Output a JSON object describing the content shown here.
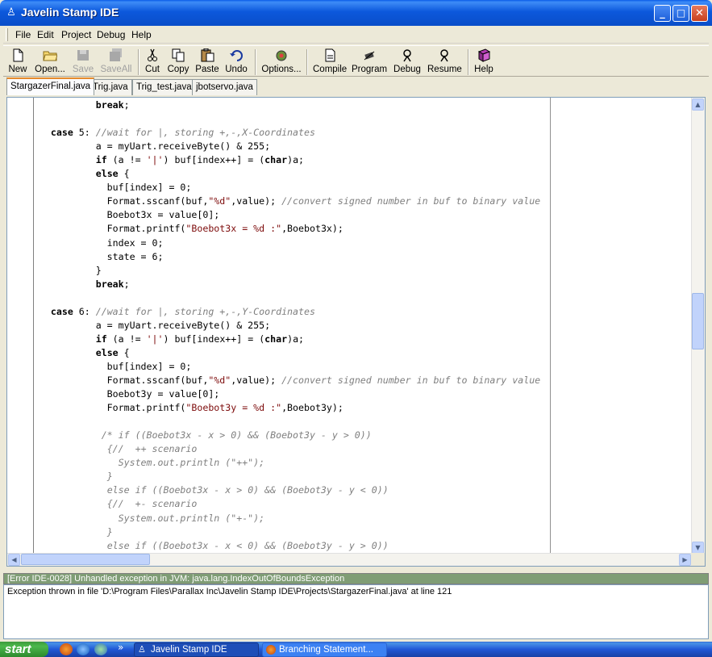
{
  "window": {
    "title": "Javelin Stamp IDE",
    "min": "_",
    "max": "□",
    "close": "✕"
  },
  "menu": [
    "File",
    "Edit",
    "Project",
    "Debug",
    "Help"
  ],
  "toolbar": {
    "new": "New",
    "open": "Open...",
    "save": "Save",
    "saveall": "SaveAll",
    "cut": "Cut",
    "copy": "Copy",
    "paste": "Paste",
    "undo": "Undo",
    "options": "Options...",
    "compile": "Compile",
    "program": "Program",
    "debug": "Debug",
    "resume": "Resume",
    "help": "Help"
  },
  "tabs": [
    "StargazerFinal.java",
    "Trig.java",
    "Trig_test.java",
    "jbotservo.java"
  ],
  "code": [
    [
      [
        "              ",
        ""
      ],
      [
        "break",
        "kw"
      ],
      [
        ";",
        ""
      ]
    ],
    [
      [
        "",
        ""
      ]
    ],
    [
      [
        "      ",
        ""
      ],
      [
        "case",
        "kw"
      ],
      [
        " 5: ",
        ""
      ],
      [
        "//wait for |, storing +,-,X-Coordinates",
        "cm"
      ]
    ],
    [
      [
        "              a = myUart.receiveByte() & 255;",
        ""
      ]
    ],
    [
      [
        "              ",
        ""
      ],
      [
        "if",
        "kw"
      ],
      [
        " (a != ",
        ""
      ],
      [
        "'|'",
        "st"
      ],
      [
        ") buf[index++] = (",
        ""
      ],
      [
        "char",
        "kw"
      ],
      [
        ")a;",
        ""
      ]
    ],
    [
      [
        "              ",
        ""
      ],
      [
        "else",
        "kw"
      ],
      [
        " {",
        ""
      ]
    ],
    [
      [
        "                buf[index] = 0;",
        ""
      ]
    ],
    [
      [
        "                Format.sscanf(buf,",
        ""
      ],
      [
        "\"%d\"",
        "st"
      ],
      [
        ",value); ",
        ""
      ],
      [
        "//convert signed number in buf to binary value",
        "cm"
      ]
    ],
    [
      [
        "                Boebot3x = value[0];",
        ""
      ]
    ],
    [
      [
        "                Format.printf(",
        ""
      ],
      [
        "\"Boebot3x = %d :\"",
        "st"
      ],
      [
        ",Boebot3x);",
        ""
      ]
    ],
    [
      [
        "                index = 0;",
        ""
      ]
    ],
    [
      [
        "                state = 6;",
        ""
      ]
    ],
    [
      [
        "              }",
        ""
      ]
    ],
    [
      [
        "              ",
        ""
      ],
      [
        "break",
        "kw"
      ],
      [
        ";",
        ""
      ]
    ],
    [
      [
        "",
        ""
      ]
    ],
    [
      [
        "      ",
        ""
      ],
      [
        "case",
        "kw"
      ],
      [
        " 6: ",
        ""
      ],
      [
        "//wait for |, storing +,-,Y-Coordinates",
        "cm"
      ]
    ],
    [
      [
        "              a = myUart.receiveByte() & 255;",
        ""
      ]
    ],
    [
      [
        "              ",
        ""
      ],
      [
        "if",
        "kw"
      ],
      [
        " (a != ",
        ""
      ],
      [
        "'|'",
        "st"
      ],
      [
        ") buf[index++] = (",
        ""
      ],
      [
        "char",
        "kw"
      ],
      [
        ")a;",
        ""
      ]
    ],
    [
      [
        "              ",
        ""
      ],
      [
        "else",
        "kw"
      ],
      [
        " {",
        ""
      ]
    ],
    [
      [
        "                buf[index] = 0;",
        ""
      ]
    ],
    [
      [
        "                Format.sscanf(buf,",
        ""
      ],
      [
        "\"%d\"",
        "st"
      ],
      [
        ",value); ",
        ""
      ],
      [
        "//convert signed number in buf to binary value",
        "cm"
      ]
    ],
    [
      [
        "                Boebot3y = value[0];",
        ""
      ]
    ],
    [
      [
        "                Format.printf(",
        ""
      ],
      [
        "\"Boebot3y = %d :\"",
        "st"
      ],
      [
        ",Boebot3y);",
        ""
      ]
    ],
    [
      [
        "",
        ""
      ]
    ],
    [
      [
        "               ",
        ""
      ],
      [
        "/* if ((Boebot3x - x > 0) && (Boebot3y - y > 0))",
        "cm"
      ]
    ],
    [
      [
        "                ",
        ""
      ],
      [
        "{//  ++ scenario",
        "cm"
      ]
    ],
    [
      [
        "                  ",
        ""
      ],
      [
        "System.out.println (\"++\");",
        "cm"
      ]
    ],
    [
      [
        "                ",
        ""
      ],
      [
        "}",
        "cm"
      ]
    ],
    [
      [
        "                ",
        ""
      ],
      [
        "else if ((Boebot3x - x > 0) && (Boebot3y - y < 0))",
        "cm"
      ]
    ],
    [
      [
        "                ",
        ""
      ],
      [
        "{//  +- scenario",
        "cm"
      ]
    ],
    [
      [
        "                  ",
        ""
      ],
      [
        "System.out.println (\"+-\");",
        "cm"
      ]
    ],
    [
      [
        "                ",
        ""
      ],
      [
        "}",
        "cm"
      ]
    ],
    [
      [
        "                ",
        ""
      ],
      [
        "else if ((Boebot3x - x < 0) && (Boebot3y - y > 0))",
        "cm"
      ]
    ]
  ],
  "output": {
    "error": "[Error IDE-0028] Unhandled exception in JVM: java.lang.IndexOutOfBoundsException",
    "message": "Exception thrown in file 'D:\\Program Files\\Parallax Inc\\Javelin Stamp IDE\\Projects\\StargazerFinal.java' at line 121"
  },
  "taskbar": {
    "start": "start",
    "more": "»",
    "tasks": [
      "Javelin Stamp IDE",
      "Branching Statement..."
    ]
  },
  "colors": {
    "keyword": "#000000",
    "comment": "#7f7f7f",
    "string": "#7d0b0b",
    "output_header": "#7f9d75",
    "titlebar": "#0a5ce8"
  }
}
